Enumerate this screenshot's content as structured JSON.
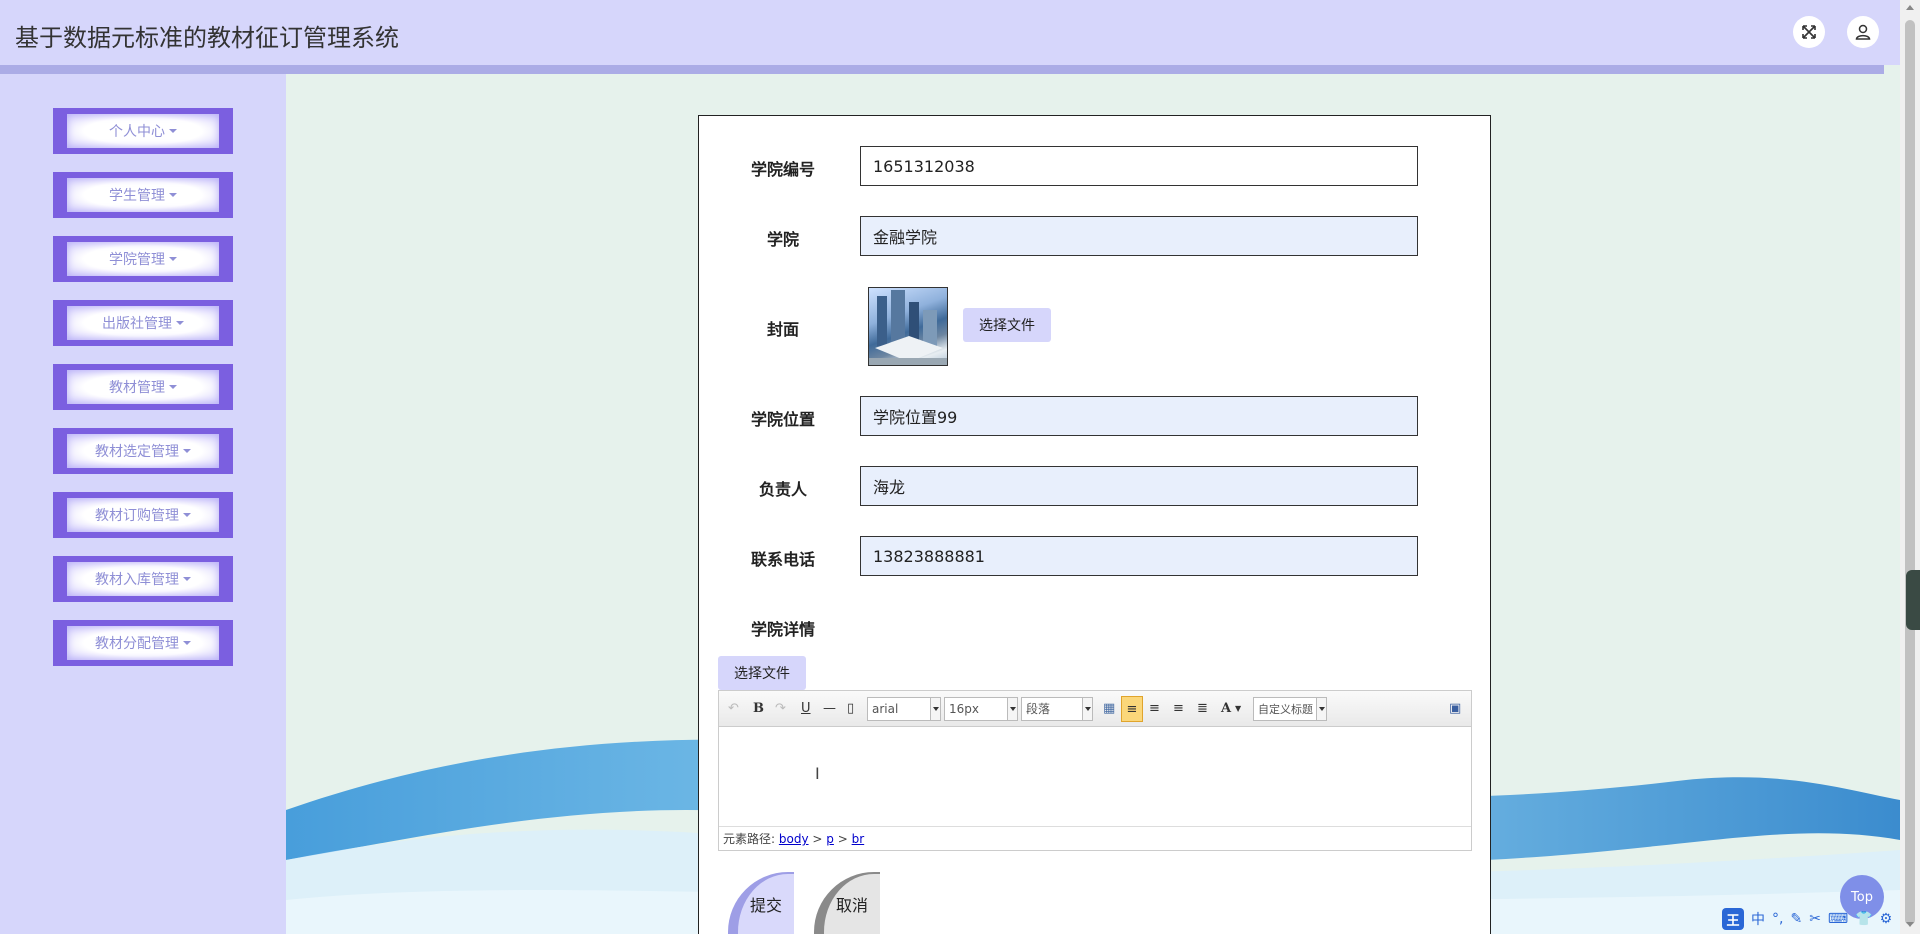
{
  "header": {
    "title": "基于数据元标准的教材征订管理系统",
    "fullscreen_icon": "expand-icon",
    "user_icon": "user-icon"
  },
  "sidebar": {
    "items": [
      {
        "label": "个人中心"
      },
      {
        "label": "学生管理"
      },
      {
        "label": "学院管理"
      },
      {
        "label": "出版社管理"
      },
      {
        "label": "教材管理"
      },
      {
        "label": "教材选定管理"
      },
      {
        "label": "教材订购管理"
      },
      {
        "label": "教材入库管理"
      },
      {
        "label": "教材分配管理"
      }
    ]
  },
  "form": {
    "college_no_label": "学院编号",
    "college_no_value": "1651312038",
    "college_label": "学院",
    "college_value": "金融学院",
    "cover_label": "封面",
    "cover_button": "选择文件",
    "location_label": "学院位置",
    "location_value": "学院位置99",
    "manager_label": "负责人",
    "manager_value": "海龙",
    "phone_label": "联系电话",
    "phone_value": "13823888881",
    "detail_label": "学院详情",
    "detail_file_button": "选择文件"
  },
  "editor": {
    "font_family": "arial",
    "font_size": "16px",
    "paragraph": "段落",
    "custom_title": "自定义标题",
    "bold": "B",
    "underline": "U",
    "font_color": "A",
    "path_prefix": "元素路径:",
    "path_body": "body",
    "path_p": "p",
    "path_br": "br",
    "path_sep": ">"
  },
  "actions": {
    "submit": "提交",
    "cancel": "取消",
    "top": "Top"
  },
  "ime": {
    "logo": "王",
    "mode": "中"
  }
}
